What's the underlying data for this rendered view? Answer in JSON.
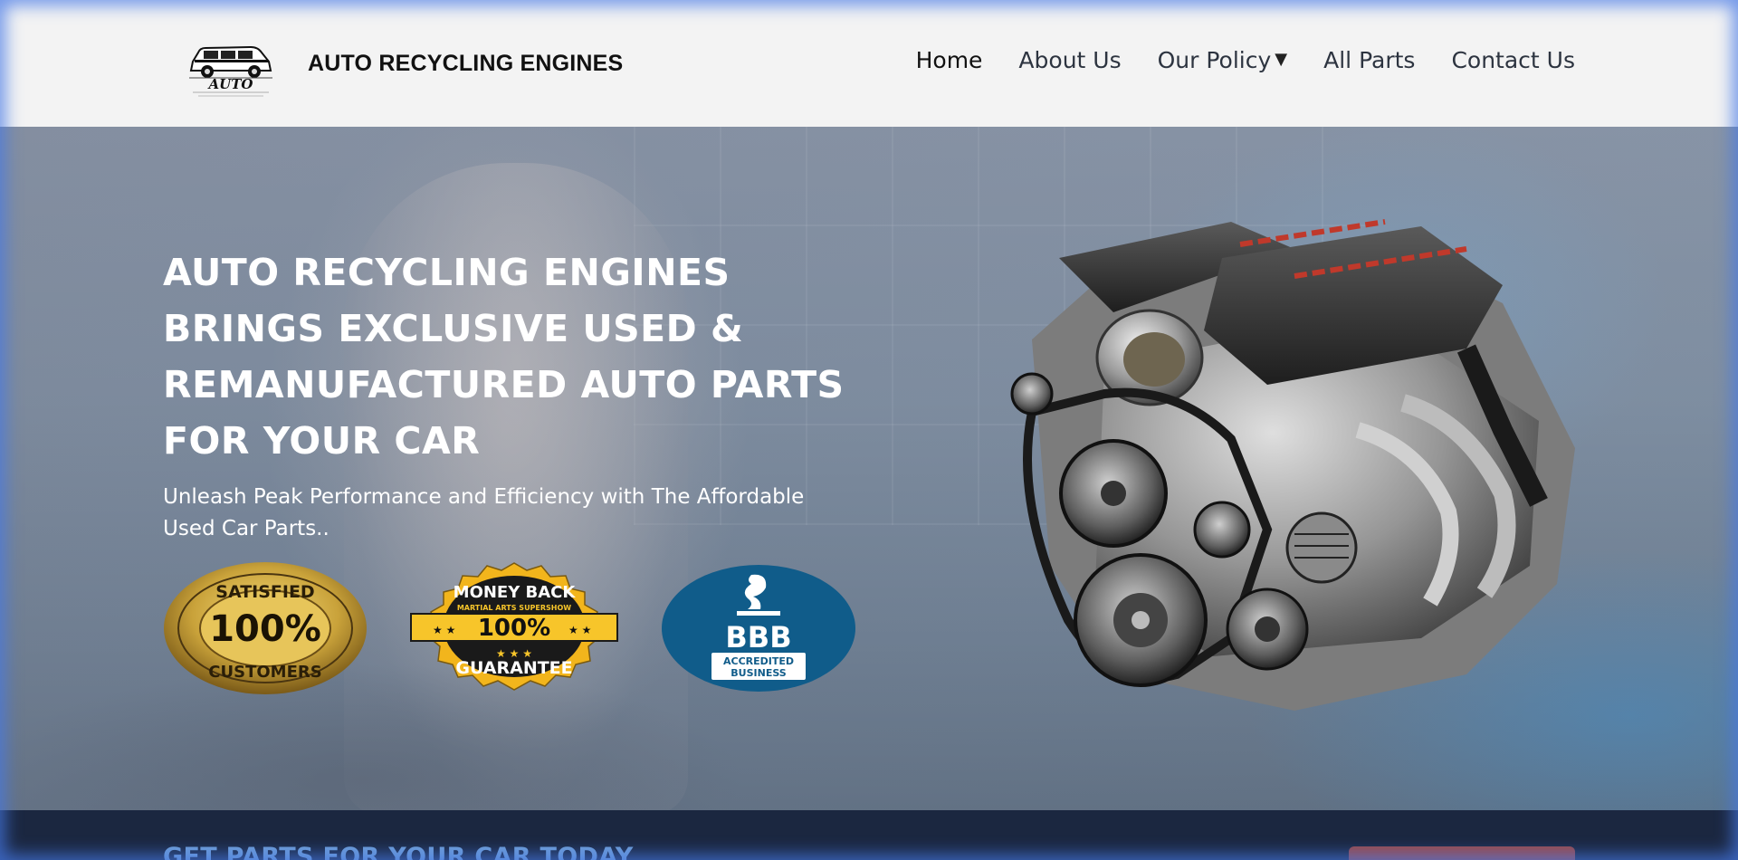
{
  "header": {
    "logo_text": "AUTO",
    "brand": "AUTO RECYCLING ENGINES",
    "nav": [
      {
        "label": "Home",
        "active": true
      },
      {
        "label": "About Us",
        "active": false
      },
      {
        "label": "Our Policy",
        "active": false,
        "has_dropdown": true
      },
      {
        "label": "All Parts",
        "active": false
      },
      {
        "label": "Contact Us",
        "active": false
      }
    ]
  },
  "hero": {
    "title": "AUTO RECYCLING ENGINES BRINGS EXCLUSIVE USED & REMANUFACTURED AUTO PARTS FOR YOUR CAR",
    "subtitle": "Unleash Peak Performance and Efficiency with The Affordable Used Car Parts..",
    "badges": [
      {
        "name": "satisfied-customers-badge",
        "top": "SATISFIED",
        "value": "100%",
        "bottom": "CUSTOMERS"
      },
      {
        "name": "money-back-guarantee-badge",
        "top": "MONEY BACK",
        "small": "MARTIAL ARTS SUPERSHOW",
        "value": "100%",
        "bottom": "GUARANTEE"
      },
      {
        "name": "bbb-accredited-badge",
        "value": "BBB",
        "bottom1": "ACCREDITED",
        "bottom2": "BUSINESS"
      }
    ]
  },
  "cta": {
    "text": "GET PARTS FOR YOUR CAR TODAY",
    "button_color": "#9a4a4a"
  },
  "colors": {
    "header_bg": "#f3f3f3",
    "cta_bg": "#1b2740",
    "cta_text": "#6f9ed6",
    "glow": "#4678e6"
  }
}
